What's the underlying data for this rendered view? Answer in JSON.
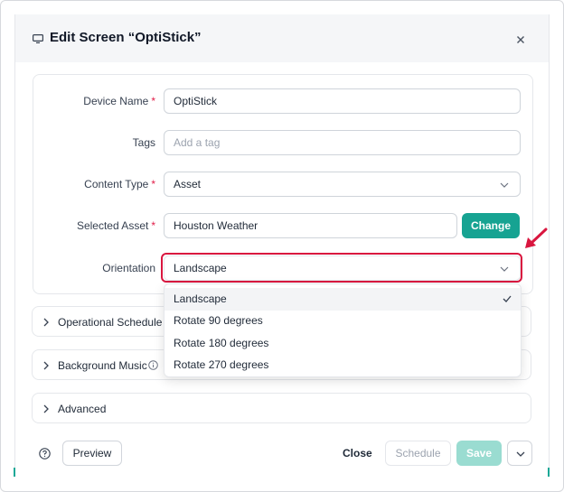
{
  "dialog": {
    "title": "Edit Screen “OptiStick”",
    "icon": "monitor-icon",
    "close_icon": "close-icon"
  },
  "form": {
    "device_name": {
      "label": "Device Name",
      "required": "*",
      "value": "OptiStick"
    },
    "tags": {
      "label": "Tags",
      "placeholder": "Add a tag"
    },
    "content_type": {
      "label": "Content Type",
      "required": "*",
      "value": "Asset"
    },
    "selected_asset": {
      "label": "Selected Asset",
      "required": "*",
      "value": "Houston Weather",
      "change_label": "Change"
    },
    "orientation": {
      "label": "Orientation",
      "value": "Landscape",
      "options": [
        "Landscape",
        "Rotate 90 degrees",
        "Rotate 180 degrees",
        "Rotate 270 degrees"
      ],
      "selected_index": 0
    }
  },
  "sections": {
    "operational_schedule": "Operational Schedule",
    "background_music": "Background Music",
    "advanced": "Advanced"
  },
  "footer": {
    "preview": "Preview",
    "close": "Close",
    "schedule": "Schedule",
    "save": "Save"
  },
  "colors": {
    "accent": "#16a392",
    "highlight": "#d9163f",
    "required": "#e11d48",
    "save_disabled": "#9adcd1"
  }
}
